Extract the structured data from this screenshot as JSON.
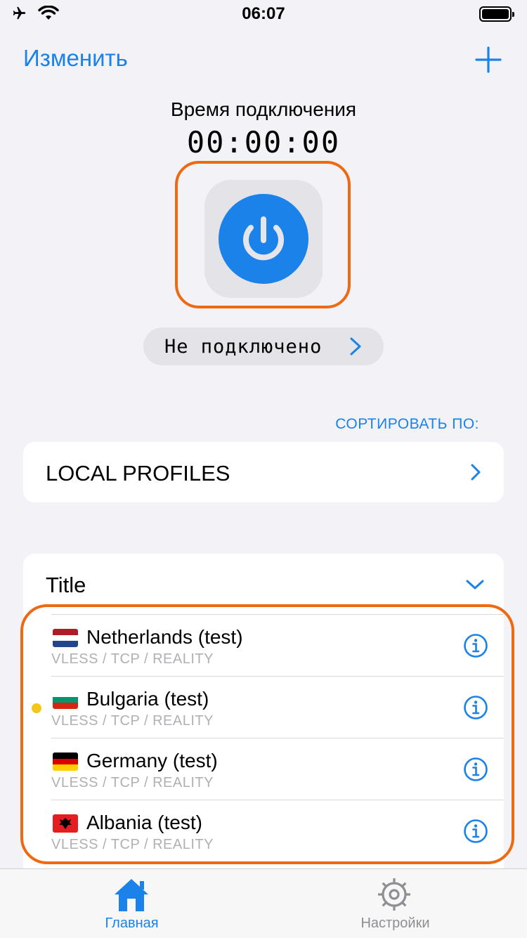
{
  "status_bar": {
    "time": "06:07"
  },
  "header": {
    "edit_label": "Изменить"
  },
  "connection": {
    "label": "Время подключения",
    "timer": "00:00:00",
    "status": "Не подключено"
  },
  "sort": {
    "label": "СОРТИРОВАТЬ ПО:"
  },
  "profiles_card": {
    "label": "LOCAL PROFILES"
  },
  "group": {
    "title": "Title",
    "servers": [
      {
        "name": "Netherlands (test)",
        "protocol": "VLESS / TCP / REALITY",
        "flag": "netherlands-flag-icon",
        "active": false
      },
      {
        "name": "Bulgaria (test)",
        "protocol": "VLESS / TCP / REALITY",
        "flag": "bulgaria-flag-icon",
        "active": true
      },
      {
        "name": "Germany (test)",
        "protocol": "VLESS / TCP / REALITY",
        "flag": "germany-flag-icon",
        "active": false
      },
      {
        "name": "Albania (test)",
        "protocol": "VLESS / TCP / REALITY",
        "flag": "albania-flag-icon",
        "active": false
      }
    ]
  },
  "tabbar": {
    "home_label": "Главная",
    "settings_label": "Настройки"
  },
  "colors": {
    "accent": "#1a82e8",
    "highlight": "#ee6a12",
    "active_dot": "#f5c518",
    "background": "#f2f2f7"
  }
}
